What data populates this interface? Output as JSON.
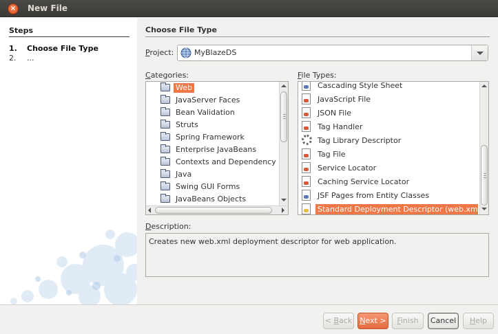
{
  "window": {
    "title": "New File"
  },
  "steps": {
    "heading": "Steps",
    "items": [
      {
        "num": "1.",
        "label": "Choose File Type"
      },
      {
        "num": "2.",
        "label": "..."
      }
    ]
  },
  "main": {
    "heading": "Choose File Type",
    "project_label_prefix": "",
    "project_label_key": "P",
    "project_label_rest": "roject:",
    "project_value": "MyBlazeDS",
    "categories_label_key": "C",
    "categories_label_rest": "ategories:",
    "file_types_label_key": "F",
    "file_types_label_rest": "ile Types:",
    "description_label_key": "D",
    "description_label_rest": "escription:",
    "description_text": "Creates new web.xml deployment descriptor for web application."
  },
  "categories": [
    {
      "label": "Web",
      "selected": true
    },
    {
      "label": "JavaServer Faces"
    },
    {
      "label": "Bean Validation"
    },
    {
      "label": "Struts"
    },
    {
      "label": "Spring Framework"
    },
    {
      "label": "Enterprise JavaBeans"
    },
    {
      "label": "Contexts and Dependency Inje"
    },
    {
      "label": "Java"
    },
    {
      "label": "Swing GUI Forms"
    },
    {
      "label": "JavaBeans Objects"
    }
  ],
  "file_types": [
    {
      "label": "Cascading Style Sheet",
      "icon": "css-file-icon"
    },
    {
      "label": "JavaScript File",
      "icon": "javascript-file-icon"
    },
    {
      "label": "JSON File",
      "icon": "json-file-icon"
    },
    {
      "label": "Tag Handler",
      "icon": "tag-handler-icon"
    },
    {
      "label": "Tag Library Descriptor",
      "icon": "tag-library-icon"
    },
    {
      "label": "Tag File",
      "icon": "tag-file-icon"
    },
    {
      "label": "Service Locator",
      "icon": "service-locator-icon"
    },
    {
      "label": "Caching Service Locator",
      "icon": "caching-service-locator-icon"
    },
    {
      "label": "JSF Pages from Entity Classes",
      "icon": "jsf-pages-icon"
    },
    {
      "label": "Standard Deployment Descriptor (web.xml)",
      "icon": "xml-descriptor-icon",
      "selected": true
    }
  ],
  "buttons": {
    "back_key": "B",
    "back_prefix": "< ",
    "back_rest": "ack",
    "next_key": "N",
    "next_rest": "ext >",
    "finish_key": "F",
    "finish_rest": "inish",
    "cancel": "Cancel",
    "help_key": "H",
    "help_rest": "elp"
  },
  "colors": {
    "selection": "#f07746",
    "primary_button": "#e56a3e",
    "titlebar": "#3b3a37"
  }
}
